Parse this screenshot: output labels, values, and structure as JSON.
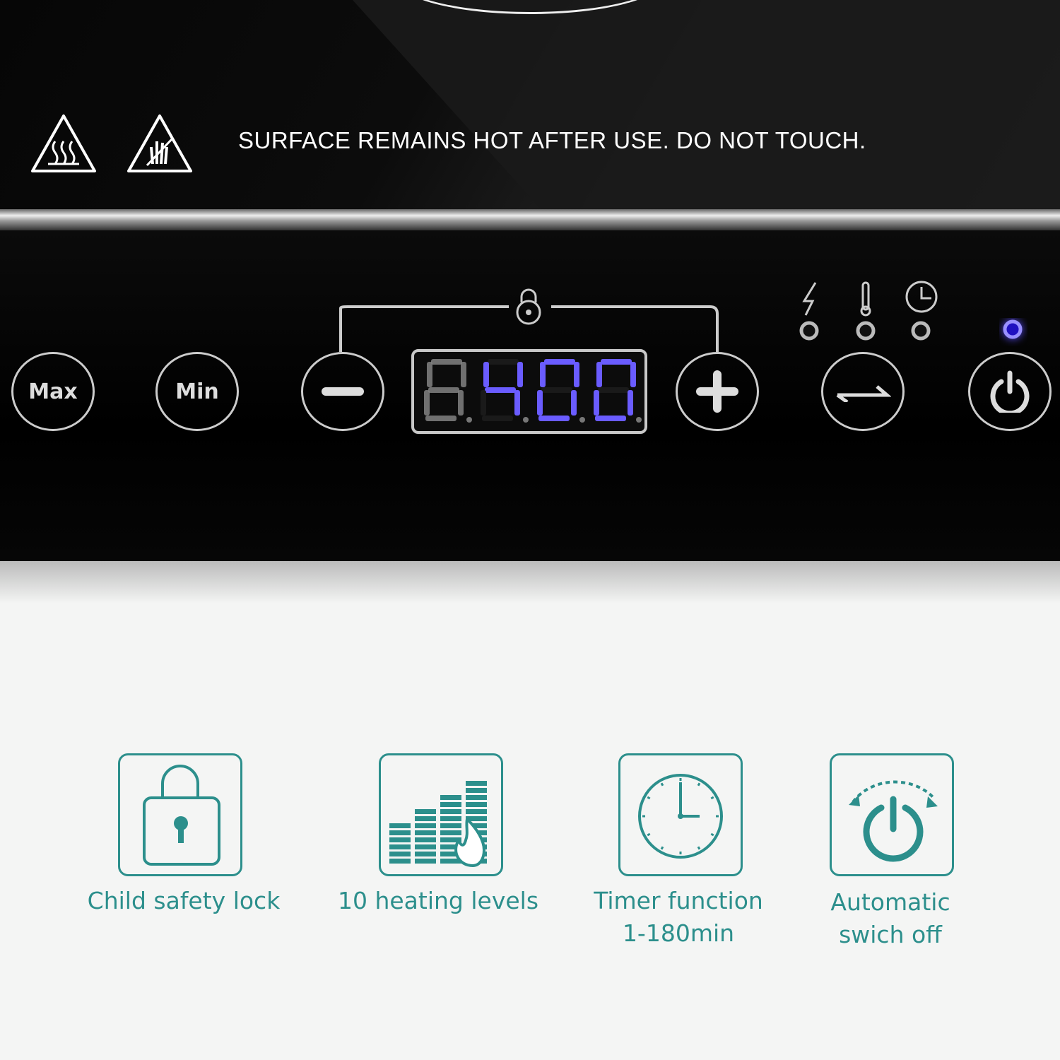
{
  "warning": {
    "text": "SURFACE REMAINS HOT AFTER USE. DO NOT TOUCH.",
    "icons": [
      "hot-surface-icon",
      "do-not-touch-icon"
    ]
  },
  "control_panel": {
    "max_label": "Max",
    "min_label": "Min",
    "display": {
      "value": "400",
      "lit_color": "#6a5cff",
      "unlit_color": "#8a8a8a"
    },
    "indicators": [
      "power-icon",
      "thermometer-icon",
      "clock-icon"
    ],
    "power_led_color": "#4a3cff"
  },
  "features": [
    {
      "label": "Child safety lock",
      "icon": "padlock-icon"
    },
    {
      "label": "10 heating levels",
      "icon": "heating-levels-icon"
    },
    {
      "label": "Timer function\n1-180min",
      "icon": "clock-icon"
    },
    {
      "label": "Automatic\nswich off",
      "icon": "auto-off-icon"
    }
  ],
  "accent_color": "#2c8f8c"
}
